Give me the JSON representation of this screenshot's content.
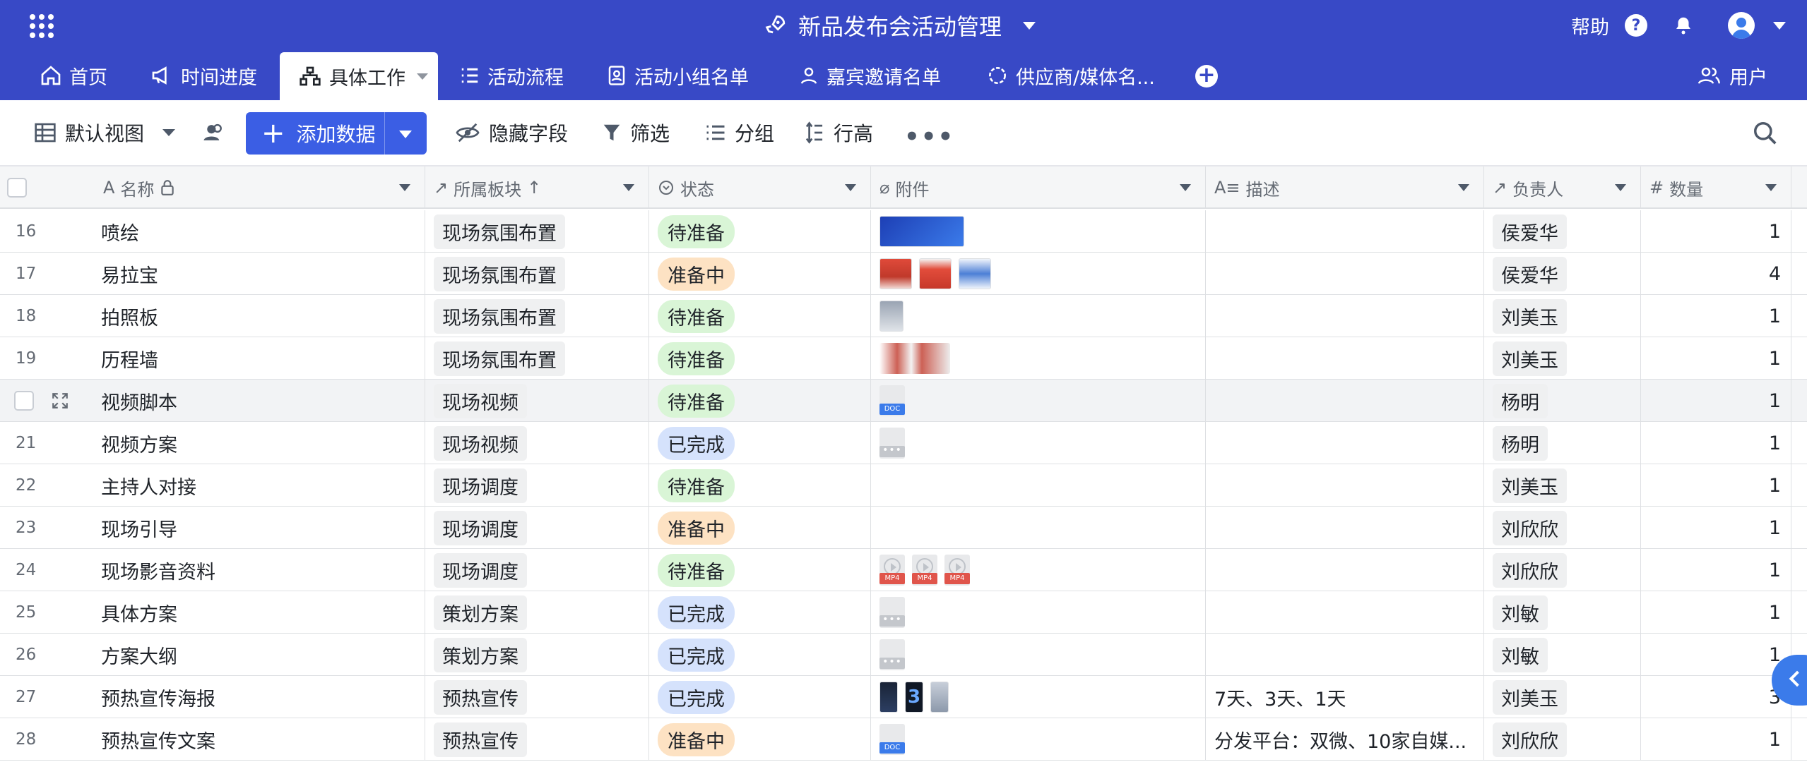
{
  "header": {
    "title": "新品发布会活动管理",
    "help": "帮助",
    "colors": {
      "bar": "#3849c6",
      "accent": "#3b5ee4"
    }
  },
  "tabs": [
    {
      "label": "首页",
      "icon": "home-icon"
    },
    {
      "label": "时间进度",
      "icon": "megaphone-icon"
    },
    {
      "label": "具体工作",
      "icon": "org-chart-icon",
      "active": true
    },
    {
      "label": "活动流程",
      "icon": "list-icon"
    },
    {
      "label": "活动小组名单",
      "icon": "contact-card-icon"
    },
    {
      "label": "嘉宾邀请名单",
      "icon": "person-icon"
    },
    {
      "label": "供应商/媒体名...",
      "icon": "gear-outline-icon"
    }
  ],
  "users_label": "用户",
  "toolbar": {
    "view": "默认视图",
    "add": "添加数据",
    "hide_fields": "隐藏字段",
    "filter": "筛选",
    "group": "分组",
    "row_height": "行高"
  },
  "columns": {
    "name": "名称",
    "block": "所属板块",
    "status": "状态",
    "attachment": "附件",
    "description": "描述",
    "owner": "负责人",
    "quantity": "数量"
  },
  "rows": [
    {
      "idx": "16",
      "name": "喷绘",
      "block": "现场氛围布置",
      "status": "待准备",
      "status_color": "green",
      "attachments": [
        "banner-image"
      ],
      "desc": "",
      "owner": "侯爱华",
      "qty": "1"
    },
    {
      "idx": "17",
      "name": "易拉宝",
      "block": "现场氛围布置",
      "status": "准备中",
      "status_color": "orange",
      "attachments": [
        "red-poster",
        "red-poster-2",
        "blue-poster"
      ],
      "desc": "",
      "owner": "侯爱华",
      "qty": "4"
    },
    {
      "idx": "18",
      "name": "拍照板",
      "block": "现场氛围布置",
      "status": "待准备",
      "status_color": "green",
      "attachments": [
        "photo"
      ],
      "desc": "",
      "owner": "刘美玉",
      "qty": "1"
    },
    {
      "idx": "19",
      "name": "历程墙",
      "block": "现场氛围布置",
      "status": "待准备",
      "status_color": "green",
      "attachments": [
        "wall"
      ],
      "desc": "",
      "owner": "刘美玉",
      "qty": "1"
    },
    {
      "idx": "",
      "name": "视频脚本",
      "block": "现场视频",
      "status": "待准备",
      "status_color": "green",
      "attachments": [
        "doc"
      ],
      "desc": "",
      "owner": "杨明",
      "qty": "1",
      "hover": true
    },
    {
      "idx": "21",
      "name": "视频方案",
      "block": "现场视频",
      "status": "已完成",
      "status_color": "blue",
      "attachments": [
        "file"
      ],
      "desc": "",
      "owner": "杨明",
      "qty": "1"
    },
    {
      "idx": "22",
      "name": "主持人对接",
      "block": "现场调度",
      "status": "待准备",
      "status_color": "green",
      "attachments": [],
      "desc": "",
      "owner": "刘美玉",
      "qty": "1"
    },
    {
      "idx": "23",
      "name": "现场引导",
      "block": "现场调度",
      "status": "准备中",
      "status_color": "orange",
      "attachments": [],
      "desc": "",
      "owner": "刘欣欣",
      "qty": "1"
    },
    {
      "idx": "24",
      "name": "现场影音资料",
      "block": "现场调度",
      "status": "待准备",
      "status_color": "green",
      "attachments": [
        "mp4",
        "mp4",
        "mp4"
      ],
      "desc": "",
      "owner": "刘欣欣",
      "qty": "1"
    },
    {
      "idx": "25",
      "name": "具体方案",
      "block": "策划方案",
      "status": "已完成",
      "status_color": "blue",
      "attachments": [
        "file"
      ],
      "desc": "",
      "owner": "刘敏",
      "qty": "1"
    },
    {
      "idx": "26",
      "name": "方案大纲",
      "block": "策划方案",
      "status": "已完成",
      "status_color": "blue",
      "attachments": [
        "file"
      ],
      "desc": "",
      "owner": "刘敏",
      "qty": "1"
    },
    {
      "idx": "27",
      "name": "预热宣传海报",
      "block": "预热宣传",
      "status": "已完成",
      "status_color": "blue",
      "attachments": [
        "dark",
        "dark3",
        "grey"
      ],
      "desc": "7天、3天、1天",
      "owner": "刘美玉",
      "qty": "3"
    },
    {
      "idx": "28",
      "name": "预热宣传文案",
      "block": "预热宣传",
      "status": "准备中",
      "status_color": "orange",
      "attachments": [
        "doc"
      ],
      "desc": "分发平台：双微、10家自媒...",
      "owner": "刘欣欣",
      "qty": "1"
    }
  ],
  "file_labels": {
    "doc": "DOC",
    "mp4": "MP4",
    "more": "•••",
    "poster_number": "3"
  }
}
